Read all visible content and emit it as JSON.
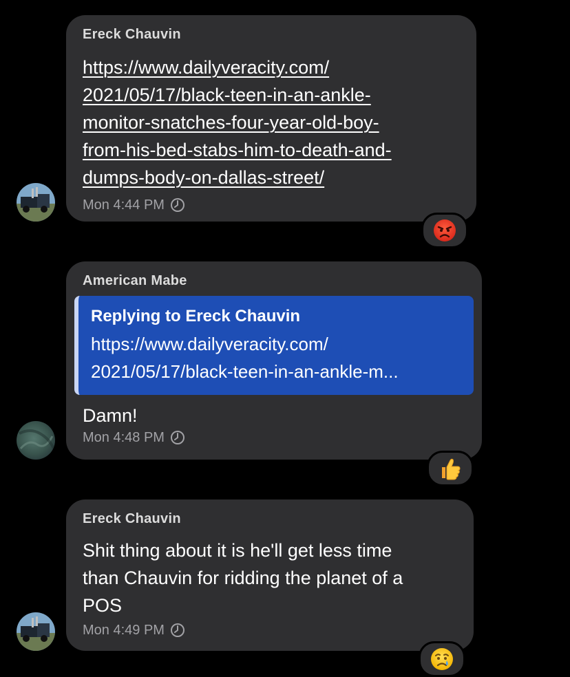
{
  "messages": [
    {
      "sender": "Ereck Chauvin",
      "link_lines": [
        "https://www.dailyveracity.com/",
        "2021/05/17/black-teen-in-an-ankle-",
        "monitor-snatches-four-year-old-boy-",
        "from-his-bed-stabs-him-to-death-and-",
        "dumps-body-on-dallas-street/"
      ],
      "time": "Mon 4:44 PM",
      "reaction": "angry-face-emoji"
    },
    {
      "sender": "American Mabe",
      "reply": {
        "title": "Replying to Ereck Chauvin",
        "line1": "https://www.dailyveracity.com/",
        "line2": "2021/05/17/black-teen-in-an-ankle-m..."
      },
      "text": "Damn!",
      "time": "Mon 4:48 PM",
      "reaction": "thumbs-up-emoji"
    },
    {
      "sender": "Ereck Chauvin",
      "text_lines": [
        "Shit thing about it is he'll get less time",
        "than Chauvin for ridding the planet of a",
        "POS"
      ],
      "time": "Mon 4:49 PM",
      "reaction": "crying-face-emoji"
    }
  ],
  "colors": {
    "background": "#000000",
    "bubble": "#2f2f31",
    "reply_box": "#1e4eb5",
    "meta_text": "#a2a2a6"
  }
}
